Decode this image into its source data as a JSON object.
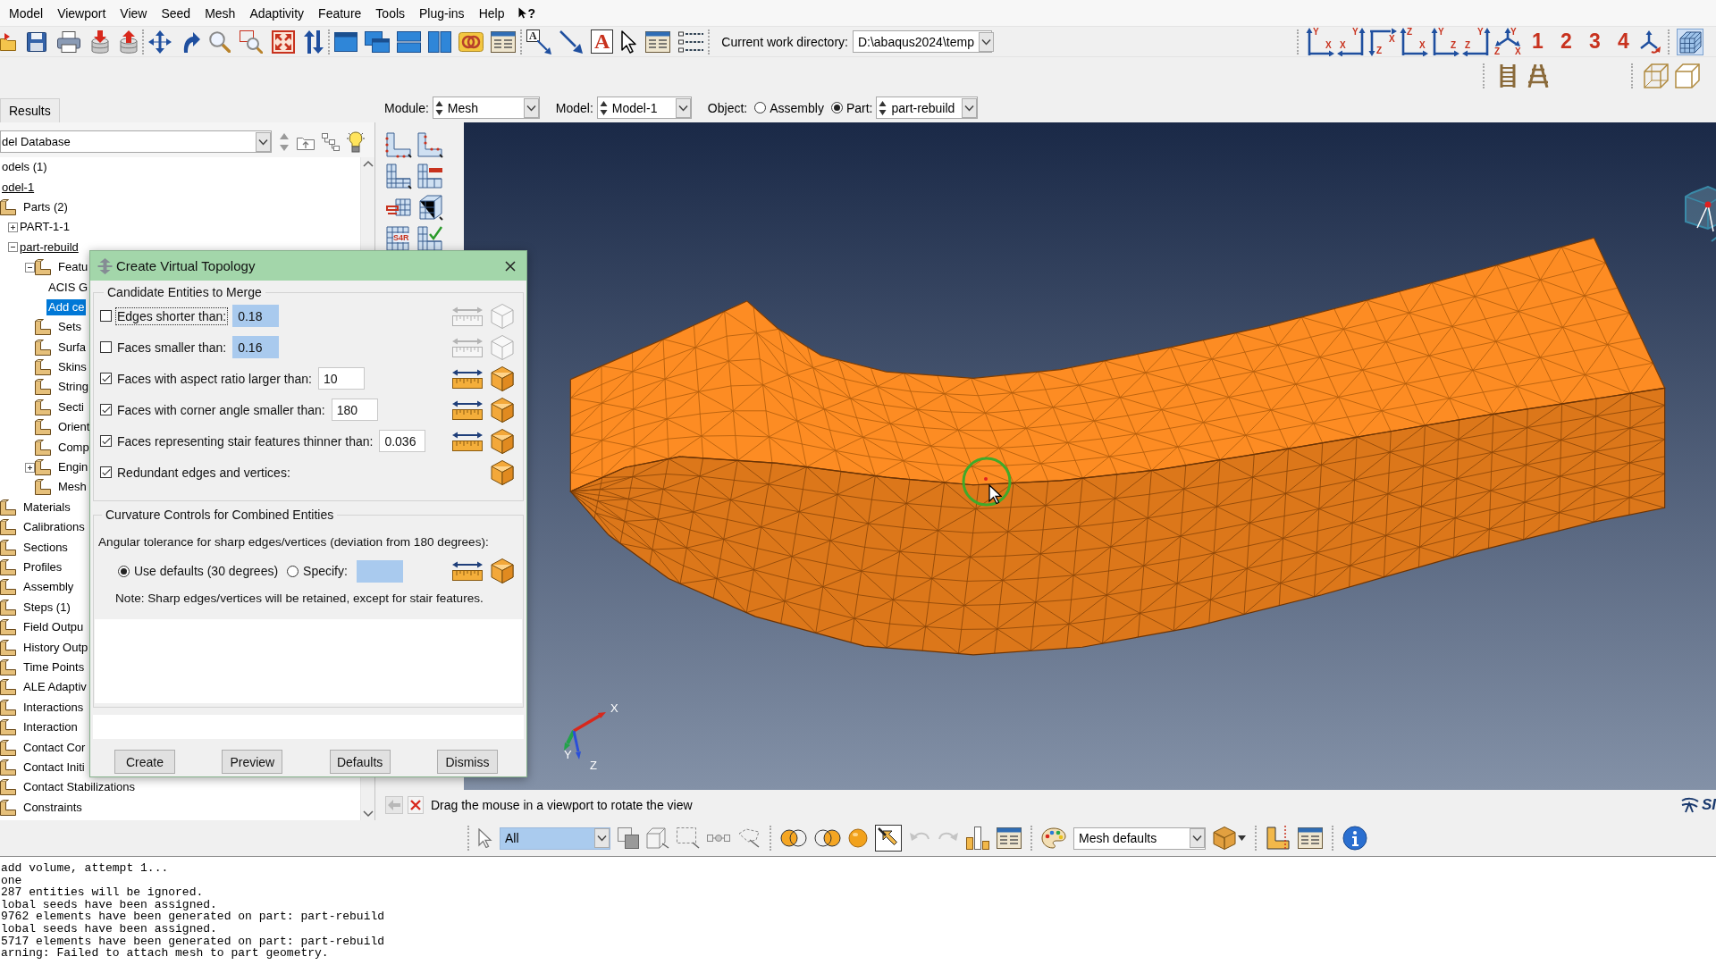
{
  "menu_bar": {
    "items": [
      "Model",
      "Viewport",
      "View",
      "Seed",
      "Mesh",
      "Adaptivity",
      "Feature",
      "Tools",
      "Plug-ins",
      "Help"
    ],
    "help_cursor": "?"
  },
  "main_toolbar": {
    "annotation_glyphs": [
      "A",
      "A"
    ],
    "work_directory": {
      "label": "Current work directory:",
      "value": "D:\\abaqus2024\\temp"
    },
    "view_buttons": [
      {
        "labels": [
          "Y",
          "X"
        ]
      },
      {
        "labels": [
          "Y",
          "X"
        ]
      },
      {
        "labels": [
          "Z",
          "X"
        ]
      },
      {
        "labels": [
          "Z",
          "X"
        ]
      },
      {
        "labels": [
          "Y",
          "Z"
        ]
      },
      {
        "labels": [
          "Y",
          "Z"
        ]
      },
      {
        "labels": [
          "Y",
          "Z",
          "X"
        ]
      }
    ],
    "viewport_numbers": [
      "1",
      "2",
      "3",
      "4"
    ],
    "mesh_display": {
      "on": true
    }
  },
  "context_bar": {
    "left_tabs": [
      {
        "label": "Results",
        "selected": false
      }
    ],
    "module": {
      "label": "Module:",
      "value": "Mesh"
    },
    "model": {
      "label": "Model:",
      "value": "Model-1"
    },
    "object": {
      "label": "Object:",
      "options": [
        {
          "label": "Assembly",
          "selected": false
        },
        {
          "label": "Part:",
          "selected": true
        }
      ]
    },
    "part": {
      "value": "part-rebuild"
    }
  },
  "model_tree": {
    "source": {
      "value": "del Database"
    },
    "nodes": [
      {
        "label": "odels (1)",
        "kind": "entry",
        "selected": false,
        "children": [
          {
            "label": "odel-1",
            "kind": "entry",
            "selected": false,
            "current": true,
            "children": [
              {
                "label": "Parts (2)",
                "kind": "container",
                "selected": false,
                "children": [
                  {
                    "label": "PART-1-1",
                    "kind": "entry",
                    "selected": false,
                    "current": false,
                    "expanded": false
                  },
                  {
                    "label": "part-rebuild",
                    "kind": "entry",
                    "selected": false,
                    "current": true,
                    "expanded": true,
                    "children": [
                      {
                        "label": "Featu",
                        "kind": "container",
                        "selected": false,
                        "expanded": true,
                        "children": [
                          {
                            "label": "ACIS G",
                            "kind": "entry",
                            "selected": false
                          },
                          {
                            "label": "Add ce",
                            "kind": "entry",
                            "selected": true
                          }
                        ]
                      },
                      {
                        "label": "Sets",
                        "kind": "container",
                        "selected": false
                      },
                      {
                        "label": "Surfa",
                        "kind": "container",
                        "selected": false
                      },
                      {
                        "label": "Skins",
                        "kind": "container",
                        "selected": false
                      },
                      {
                        "label": "String",
                        "kind": "container",
                        "selected": false
                      },
                      {
                        "label": "Secti",
                        "kind": "container",
                        "selected": false
                      },
                      {
                        "label": "Orient",
                        "kind": "container",
                        "selected": false
                      },
                      {
                        "label": "Comp",
                        "kind": "container",
                        "selected": false
                      },
                      {
                        "label": "Engin",
                        "kind": "container",
                        "selected": false,
                        "expanded": false
                      },
                      {
                        "label": "Mesh",
                        "kind": "container",
                        "selected": false
                      }
                    ]
                  }
                ]
              },
              {
                "label": "Materials",
                "kind": "container",
                "selected": false
              },
              {
                "label": "Calibrations",
                "kind": "container",
                "selected": false
              },
              {
                "label": "Sections",
                "kind": "container",
                "selected": false
              },
              {
                "label": "Profiles",
                "kind": "container",
                "selected": false
              },
              {
                "label": "Assembly",
                "kind": "container",
                "selected": false
              },
              {
                "label": "Steps (1)",
                "kind": "container",
                "selected": false
              },
              {
                "label": "Field Outpu",
                "kind": "container",
                "selected": false
              },
              {
                "label": "History Outp",
                "kind": "container",
                "selected": false
              },
              {
                "label": "Time Points",
                "kind": "container",
                "selected": false
              },
              {
                "label": "ALE Adaptiv",
                "kind": "container",
                "selected": false
              },
              {
                "label": "Interactions",
                "kind": "container",
                "selected": false
              },
              {
                "label": "Interaction",
                "kind": "container",
                "selected": false
              },
              {
                "label": "Contact Cor",
                "kind": "container",
                "selected": false
              },
              {
                "label": "Contact Initi",
                "kind": "container",
                "selected": false
              },
              {
                "label": "Contact Stabilizations",
                "kind": "container",
                "selected": false
              },
              {
                "label": "Constraints",
                "kind": "container",
                "selected": false
              }
            ]
          }
        ]
      }
    ]
  },
  "tool_strip": {
    "element_type_label": "S4R"
  },
  "viewport": {
    "triad": {
      "x": "X",
      "y": "Y",
      "z": "Z"
    }
  },
  "prompt_bar": {
    "back": {
      "disabled": true
    },
    "text": "Drag the mouse in a viewport to rotate the view",
    "logo_text": "SI"
  },
  "selection_toolbar": {
    "filter": {
      "value": "All"
    },
    "undo": {
      "disabled": true
    },
    "redo": {
      "disabled": true
    },
    "pick_tool": {
      "on": true
    },
    "display_group": {
      "value": "Mesh defaults"
    }
  },
  "message_area": {
    "lines": [
      "add volume, attempt 1...",
      "one",
      "287 entities will be ignored.",
      "lobal seeds have been assigned.",
      "9762 elements have been generated on part: part-rebuild",
      "lobal seeds have been assigned.",
      "5717 elements have been generated on part: part-rebuild",
      "arning: Failed to attach mesh to part geometry."
    ]
  },
  "dialog": {
    "title": "Create Virtual Topology",
    "candidates": {
      "title": "Candidate Entities to Merge",
      "rows": [
        {
          "kind": "threshold",
          "label": "Edges shorter than:",
          "checked": false,
          "focused": true,
          "value": "0.18"
        },
        {
          "kind": "threshold",
          "label": "Faces smaller than:",
          "checked": false,
          "focused": false,
          "value": "0.16"
        },
        {
          "kind": "threshold",
          "label": "Faces with aspect ratio larger than:",
          "checked": true,
          "focused": false,
          "value": "10"
        },
        {
          "kind": "threshold",
          "label": "Faces with corner angle smaller than:",
          "checked": true,
          "focused": false,
          "value": "180"
        },
        {
          "kind": "threshold",
          "label": "Faces representing stair features thinner than:",
          "checked": true,
          "focused": false,
          "value": "0.036"
        },
        {
          "kind": "flag",
          "label": "Redundant edges and vertices:",
          "checked": true,
          "focused": false
        }
      ]
    },
    "curvature": {
      "title": "Curvature Controls for Combined Entities",
      "prompt": "Angular tolerance for sharp edges/vertices (deviation from 180 degrees):",
      "options": [
        {
          "label": "Use defaults (30 degrees)",
          "selected": true
        },
        {
          "label": "Specify:",
          "selected": false
        }
      ],
      "note": "Note: Sharp edges/vertices will be retained, except for stair features."
    },
    "buttons": [
      "Create",
      "Preview",
      "Defaults",
      "Dismiss"
    ]
  }
}
